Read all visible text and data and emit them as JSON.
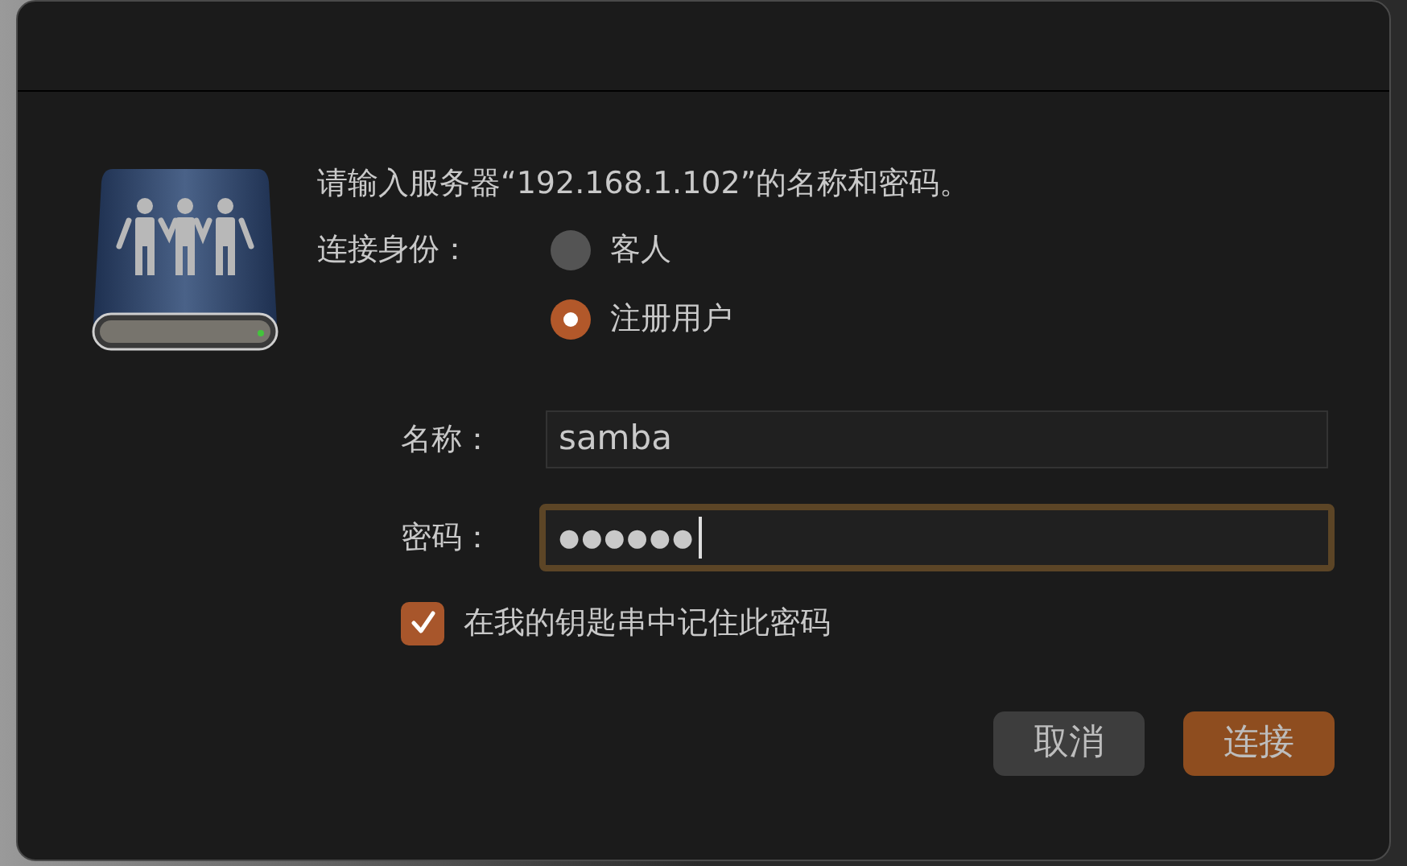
{
  "message": "请输入服务器“192.168.1.102”的名称和密码。",
  "connect_as": {
    "label": "连接身份：",
    "options": [
      {
        "label": "客人",
        "selected": false
      },
      {
        "label": "注册用户",
        "selected": true
      }
    ]
  },
  "fields": [
    {
      "label": "名称：",
      "value": "samba",
      "focused": false
    },
    {
      "label": "密码：",
      "value": "●●●●●●",
      "focused": true
    }
  ],
  "remember": {
    "label": "在我的钥匙串中记住此密码",
    "checked": true
  },
  "buttons": [
    {
      "label": "取消",
      "kind": "secondary"
    },
    {
      "label": "连接",
      "kind": "primary"
    }
  ]
}
